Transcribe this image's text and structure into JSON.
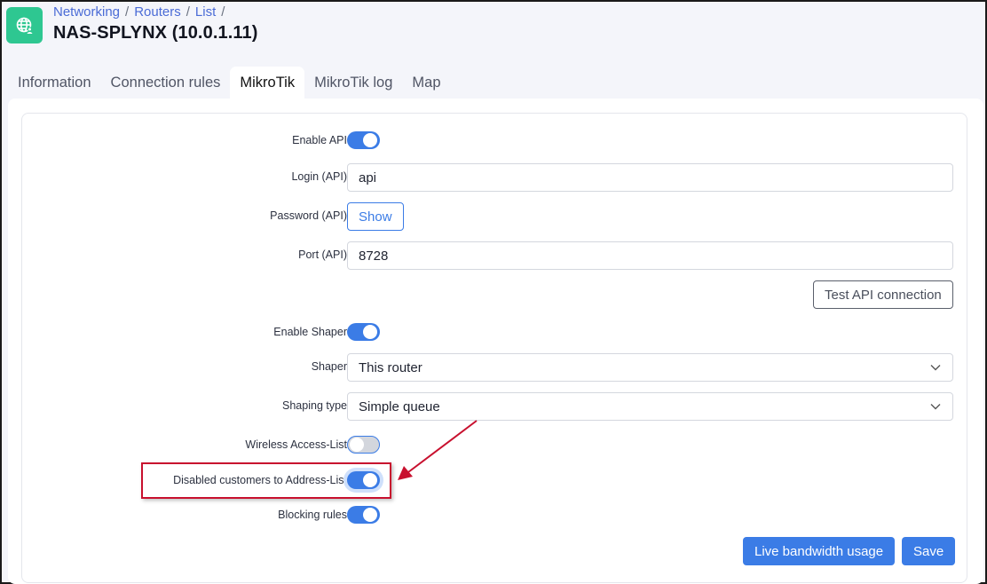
{
  "header": {
    "icon": "globe-user-icon",
    "breadcrumb": [
      "Networking",
      "Routers",
      "List"
    ],
    "breadcrumb_separator": "/",
    "title": "NAS-SPLYNX (10.0.1.11)"
  },
  "tabs": [
    {
      "label": "Information",
      "active": false
    },
    {
      "label": "Connection rules",
      "active": false
    },
    {
      "label": "MikroTik",
      "active": true
    },
    {
      "label": "MikroTik log",
      "active": false
    },
    {
      "label": "Map",
      "active": false
    }
  ],
  "form": {
    "enable_api": {
      "label": "Enable API",
      "checked": true
    },
    "login_api": {
      "label": "Login (API)",
      "value": "api"
    },
    "password_api": {
      "label": "Password (API)",
      "button": "Show"
    },
    "port_api": {
      "label": "Port (API)",
      "value": "8728"
    },
    "test_api_button": "Test API connection",
    "enable_shaper": {
      "label": "Enable Shaper",
      "checked": true
    },
    "shaper": {
      "label": "Shaper",
      "value": "This router"
    },
    "shaping_type": {
      "label": "Shaping type",
      "value": "Simple queue"
    },
    "wireless_access_list": {
      "label": "Wireless Access-List",
      "checked": false
    },
    "disabled_customers_address_list": {
      "label": "Disabled customers to Address-List",
      "checked": true,
      "highlighted": true
    },
    "blocking_rules": {
      "label": "Blocking rules",
      "checked": true
    }
  },
  "actions": {
    "live_bandwidth": "Live bandwidth usage",
    "save": "Save"
  },
  "colors": {
    "accent": "#3b7ce6",
    "app_icon": "#2ec791",
    "annotation": "#c8102e"
  }
}
